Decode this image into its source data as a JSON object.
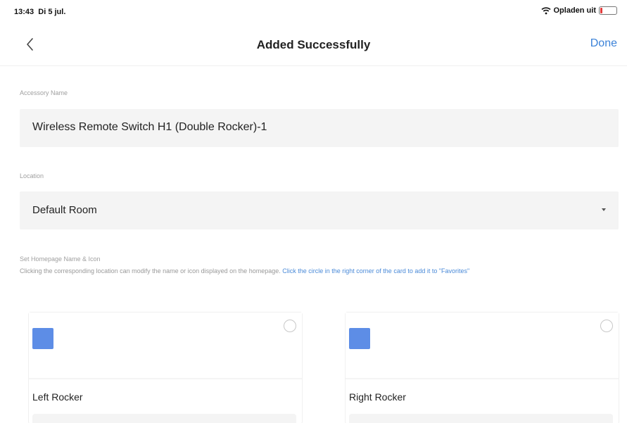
{
  "status_bar": {
    "time": "13:43",
    "date": "Di 5 jul.",
    "charging": "Opladen uit"
  },
  "nav": {
    "title": "Added Successfully",
    "done_label": "Done"
  },
  "accessory": {
    "label": "Accessory Name",
    "value": "Wireless Remote Switch H1 (Double Rocker)-1"
  },
  "location": {
    "label": "Location",
    "value": "Default Room"
  },
  "homepage": {
    "heading": "Set Homepage Name & Icon",
    "hint": "Clicking the corresponding location can modify the name or icon displayed on the homepage.",
    "hint_link": "Click the circle in the right corner of the card to add it to \"Favorites\""
  },
  "cards": [
    {
      "label": "Left Rocker"
    },
    {
      "label": "Right Rocker"
    }
  ],
  "colors": {
    "accent": "#3b82d8",
    "icon_tile": "#5d8de6",
    "field_bg": "#f4f4f4"
  }
}
